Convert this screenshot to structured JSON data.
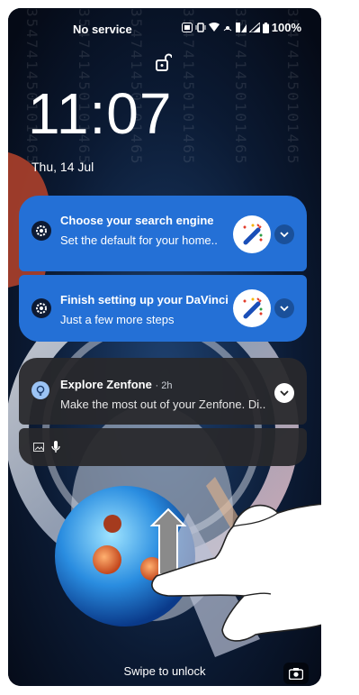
{
  "status_bar": {
    "carrier": "No service",
    "battery": "100%"
  },
  "lockscreen": {
    "time": "11:07",
    "date": "Thu, 14 Jul"
  },
  "notifications": [
    {
      "title": "Choose your search engine",
      "body": "Set the default for your home.."
    },
    {
      "title": "Finish setting up your DaVinci",
      "body": "Just a few more steps"
    },
    {
      "title": "Explore Zenfone",
      "time": "· 2h",
      "body": "Make the most out of your Zenfone. Di.."
    }
  ],
  "swipe_text": "Swipe to unlock",
  "watermark_code": "354741450101465",
  "colors": {
    "notification_blue": "#2470d6",
    "dark_card": "#28282c"
  },
  "icons": [
    "lock-open-icon",
    "gear-icon",
    "lightbulb-icon",
    "image-icon",
    "mic-icon",
    "chevron-down-icon",
    "camera-icon"
  ]
}
